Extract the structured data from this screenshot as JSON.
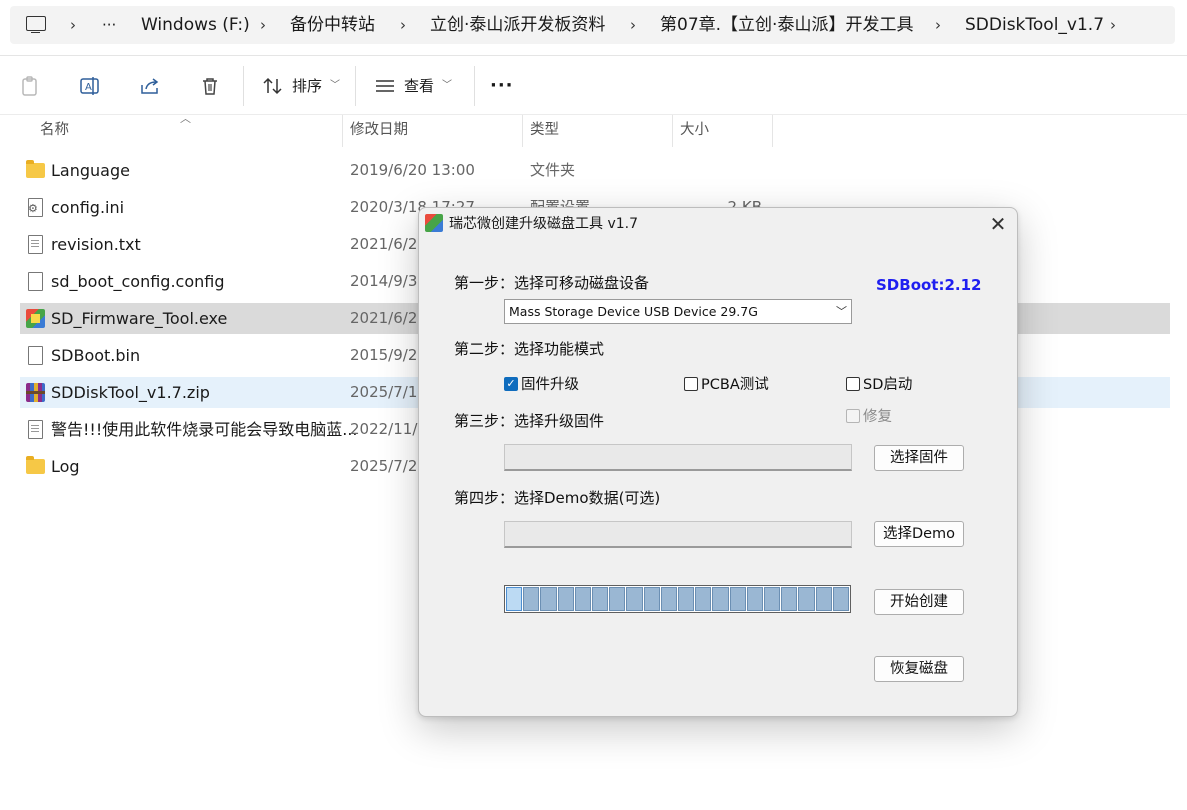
{
  "explorer": {
    "breadcrumb": {
      "more": "···",
      "separator": "›",
      "items": [
        "Windows (F:)",
        "备份中转站",
        "立创·泰山派开发板资料",
        "第07章.【立创·泰山派】开发工具",
        "SDDiskTool_v1.7"
      ]
    },
    "toolbar": {
      "sort_label": "排序",
      "view_label": "查看",
      "more_label": "···"
    },
    "columns": {
      "name": "名称",
      "modified": "修改日期",
      "type": "类型",
      "size": "大小"
    },
    "files": [
      {
        "name": "Language",
        "date": "2019/6/20 13:00",
        "type": "文件夹",
        "size": "",
        "icon": "folder-icon"
      },
      {
        "name": "config.ini",
        "date": "2020/3/18 17:27",
        "type": "配置设置",
        "size": "2 KB",
        "icon": "settings-file-icon"
      },
      {
        "name": "revision.txt",
        "date": "2021/6/2",
        "type": "",
        "size": "",
        "icon": "text-file-icon"
      },
      {
        "name": "sd_boot_config.config",
        "date": "2014/9/3",
        "type": "",
        "size": "",
        "icon": "file-icon"
      },
      {
        "name": "SD_Firmware_Tool.exe",
        "date": "2021/6/2",
        "type": "",
        "size": "",
        "icon": "exe-icon"
      },
      {
        "name": "SDBoot.bin",
        "date": "2015/9/29",
        "type": "",
        "size": "",
        "icon": "file-icon"
      },
      {
        "name": "SDDiskTool_v1.7.zip",
        "date": "2025/7/1",
        "type": "",
        "size": "",
        "icon": "zip-icon"
      },
      {
        "name": "警告!!!使用此软件烧录可能会导致电脑蓝...",
        "date": "2022/11/",
        "type": "",
        "size": "",
        "icon": "text-file-icon"
      },
      {
        "name": "Log",
        "date": "2025/7/2",
        "type": "",
        "size": "",
        "icon": "folder-icon"
      }
    ]
  },
  "dialog": {
    "title": "瑞芯微创建升级磁盘工具 v1.7",
    "close": "✕",
    "step1": "第一步：选择可移动磁盘设备",
    "sdboot_version": "SDBoot:2.12",
    "device": "Mass Storage Device USB Device   29.7G",
    "step2": "第二步：选择功能模式",
    "modes": {
      "firmware_upgrade": {
        "label": "固件升级",
        "checked": true
      },
      "pcba_test": {
        "label": "PCBA测试",
        "checked": false
      },
      "sd_boot": {
        "label": "SD启动",
        "checked": false
      },
      "repair": {
        "label": "修复",
        "checked": false,
        "disabled": true
      }
    },
    "step3": "第三步：选择升级固件",
    "firmware_path": "",
    "select_firmware_button": "选择固件",
    "step4": "第四步：选择Demo数据(可选)",
    "demo_path": "",
    "select_demo_button": "选择Demo",
    "start_button": "开始创建",
    "restore_button": "恢复磁盘",
    "progress_segments": 20
  },
  "colors": {
    "sdboot_text": "#1e1ef0",
    "checkbox_checked": "#0f6cbd",
    "selected_row": "#dadada",
    "hover_row": "#e5f1fb"
  }
}
